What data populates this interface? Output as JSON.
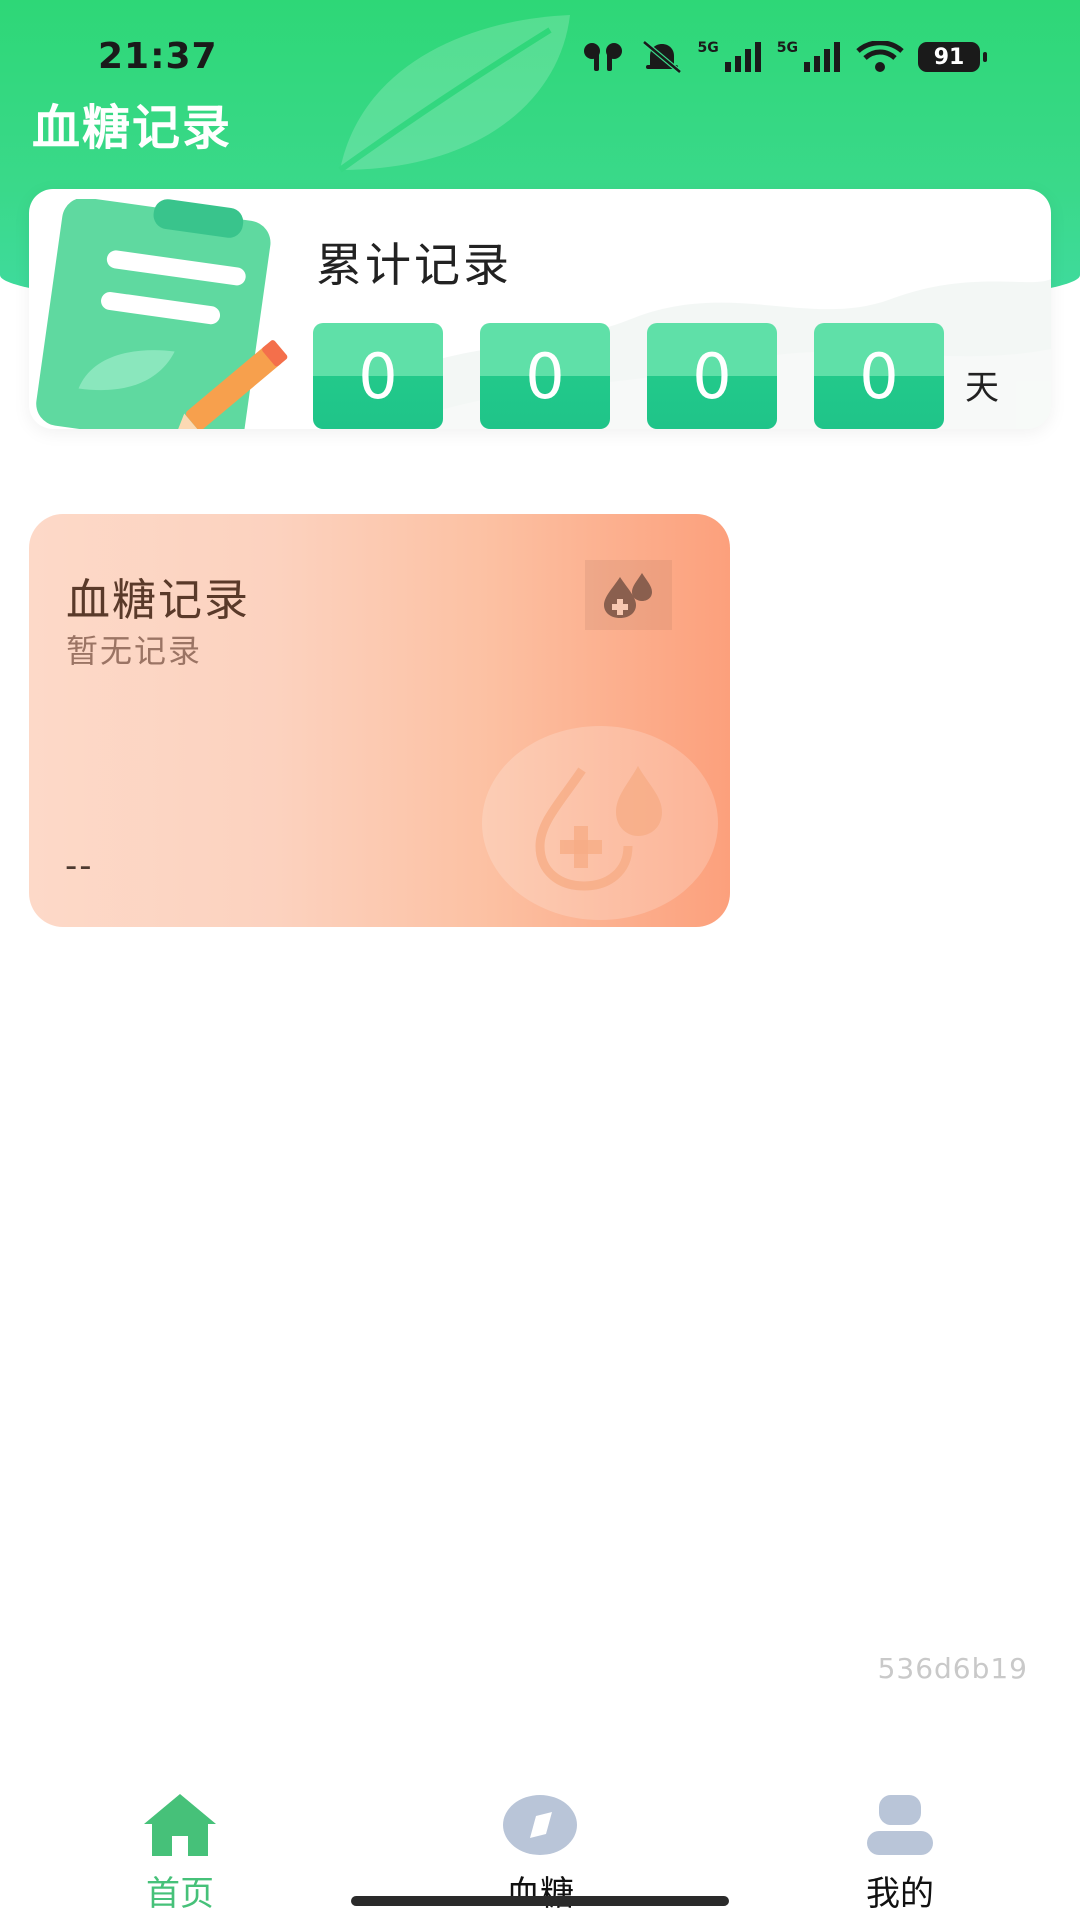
{
  "status_bar": {
    "time": "21:37",
    "signal_label_1": "5G",
    "signal_label_2": "5G",
    "battery_level": "91"
  },
  "header": {
    "title": "血糖记录"
  },
  "summary": {
    "title": "累计记录",
    "digits": [
      "0",
      "0",
      "0",
      "0"
    ],
    "unit": "天"
  },
  "record_card": {
    "title": "血糖记录",
    "subtitle": "暂无记录",
    "value": "--"
  },
  "build_id": "536d6b19",
  "tabbar": {
    "items": [
      {
        "label": "首页",
        "icon": "home-icon",
        "active": true
      },
      {
        "label": "血糖",
        "icon": "compass-icon",
        "active": false
      },
      {
        "label": "我的",
        "icon": "user-icon",
        "active": false
      }
    ]
  },
  "colors": {
    "header_green": "#2ed777",
    "digit_green": "#22c98a",
    "tab_active": "#46c179",
    "tab_inactive_icon": "#b9c5d8",
    "record_card_start": "#fdd9c8",
    "record_card_end": "#fca07c"
  }
}
